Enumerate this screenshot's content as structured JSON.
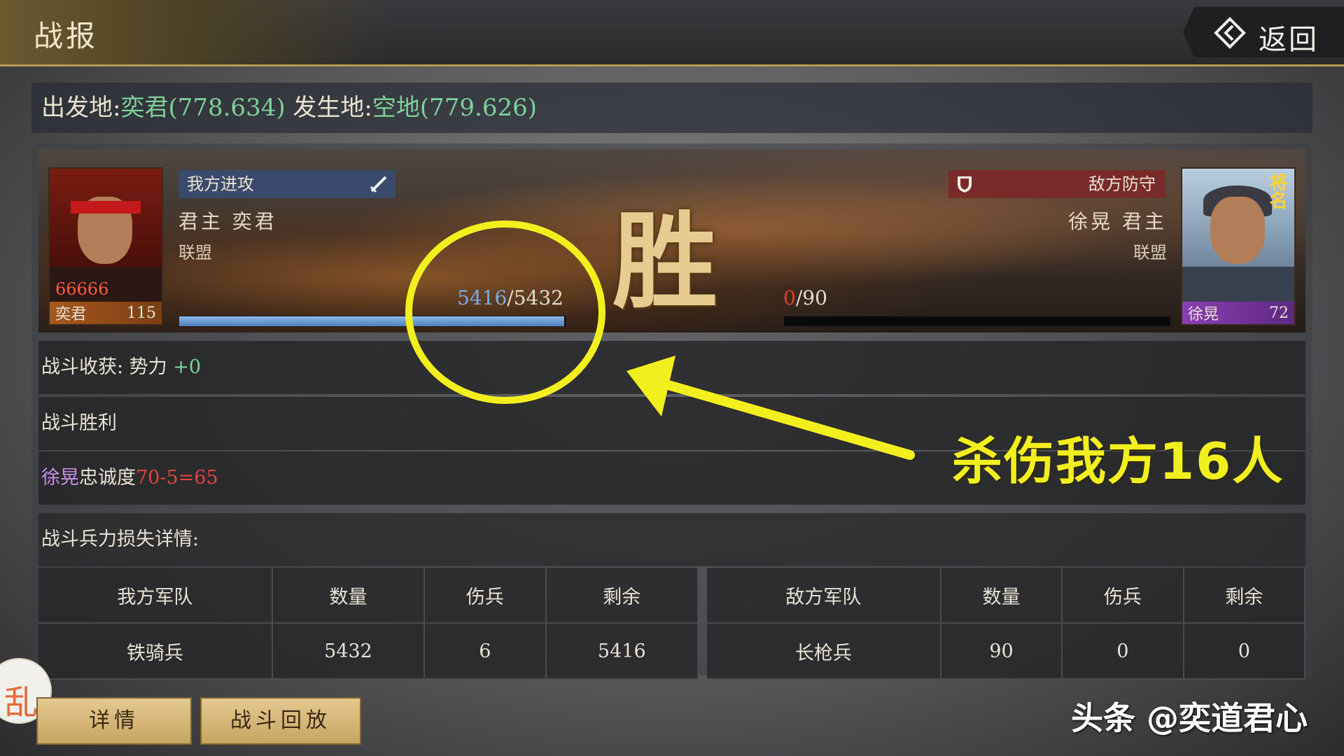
{
  "header": {
    "title": "战报",
    "back_label": "返回"
  },
  "location": {
    "origin_label": "出发地:",
    "origin_value": "奕君(778.634)",
    "site_label": "发生地:",
    "site_value": "空地(779.626)"
  },
  "attacker": {
    "tag": "我方进攻",
    "name": "君主  奕君",
    "alliance": "联盟",
    "portrait_name": "奕君",
    "level": "115",
    "stars": "66666",
    "troops_current": "5416",
    "troops_total": "/5432",
    "troops_fraction": 0.997
  },
  "defender": {
    "tag": "敌方防守",
    "name": "徐晃  君主",
    "alliance": "联盟",
    "portrait_name": "徐晃",
    "level": "72",
    "badge": "将名",
    "troops_current": "0",
    "troops_total": "/90",
    "troops_fraction": 0
  },
  "victory": "胜",
  "rows": {
    "rewards_label": "战斗收获:  势力 ",
    "rewards_value": "+0",
    "result": "战斗胜利",
    "loyalty_name": "徐晃",
    "loyalty_label": "忠诚度",
    "loyalty_value": "70-5=65",
    "loss_title": "战斗兵力损失详情:"
  },
  "loss_table": {
    "left_headers": [
      "我方军队",
      "数量",
      "伤兵",
      "剩余"
    ],
    "right_headers": [
      "敌方军队",
      "数量",
      "伤兵",
      "剩余"
    ],
    "left_row": [
      "铁骑兵",
      "5432",
      "6",
      "5416"
    ],
    "right_row": [
      "长枪兵",
      "90",
      "0",
      "0"
    ]
  },
  "buttons": {
    "detail": "详情",
    "replay": "战斗回放"
  },
  "side_bubble": "乱",
  "annotation": {
    "text": "杀伤我方16人",
    "color": "#f2ef1e"
  },
  "watermark": "头条 @奕道君心"
}
